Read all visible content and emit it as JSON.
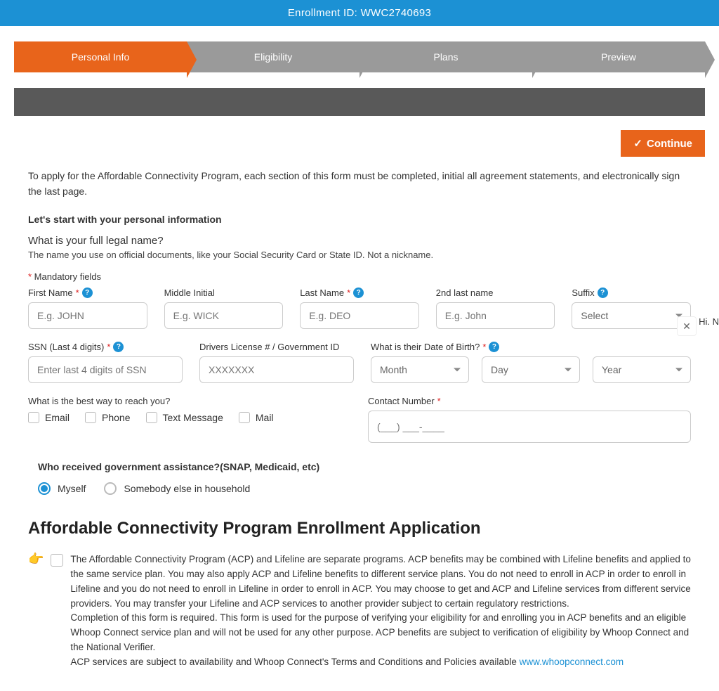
{
  "top": {
    "enrollment": "Enrollment ID: WWC2740693"
  },
  "steps": [
    "Personal Info",
    "Eligibility",
    "Plans",
    "Preview"
  ],
  "continue": "Continue",
  "intro": "To apply for the Affordable Connectivity Program, each section of this form must be completed, initial all agreement statements, and electronically sign the last page.",
  "lets_start": "Let's start with your personal information",
  "legal_name_q": "What is your full legal name?",
  "legal_name_sub": "The name you use on official documents, like your Social Security Card or State ID. Not a nickname.",
  "mandatory_prefix": "*",
  "mandatory_label": " Mandatory fields",
  "labels": {
    "first": "First Name ",
    "middle": "Middle Initial",
    "last": "Last Name ",
    "second_last": "2nd last name",
    "suffix": "Suffix ",
    "ssn": "SSN (Last 4 digits) ",
    "dl": "Drivers License # / Government ID",
    "dob": "What is their Date of Birth? ",
    "reach": "What is the best way to reach you?",
    "contact": "Contact Number "
  },
  "placeholders": {
    "first": "E.g. JOHN",
    "middle": "E.g. WICK",
    "last": "E.g. DEO",
    "second_last": "E.g. John",
    "suffix": "Select",
    "ssn": "Enter last 4 digits of SSN",
    "dl": "XXXXXXX",
    "month": "Month",
    "day": "Day",
    "year": "Year",
    "contact": "(___) ___-____"
  },
  "contact_opts": [
    "Email",
    "Phone",
    "Text Message",
    "Mail"
  ],
  "assist_q": "Who received government assistance?(SNAP, Medicaid, etc)",
  "assist_opts": [
    "Myself",
    "Somebody else in household"
  ],
  "app_title": "Affordable Connectivity Program Enrollment Application",
  "ack_p1": "The Affordable Connectivity Program (ACP) and Lifeline are separate programs. ACP benefits may be combined with Lifeline benefits and applied to the same service plan. You may also apply ACP and Lifeline benefits to different service plans. You do not need to enroll in ACP in order to enroll in Lifeline and you do not need to enroll in Lifeline in order to enroll in ACP. You may choose to get and ACP and Lifeline services from different service providers. You may transfer your Lifeline and ACP services to another provider subject to certain regulatory restrictions.",
  "ack_p2": "Completion of this form is required. This form is used for the purpose of verifying your eligibility for and enrolling you in ACP benefits and an eligible Whoop Connect service plan and will not be used for any other purpose. ACP benefits are subject to verification of eligibility by Whoop Connect and the National Verifier.",
  "ack_p3_prefix": "ACP services are subject to availability and Whoop Connect's Terms and Conditions and Policies available ",
  "ack_link": "www.whoopconnect.com",
  "widget_hi": "Hi. N"
}
